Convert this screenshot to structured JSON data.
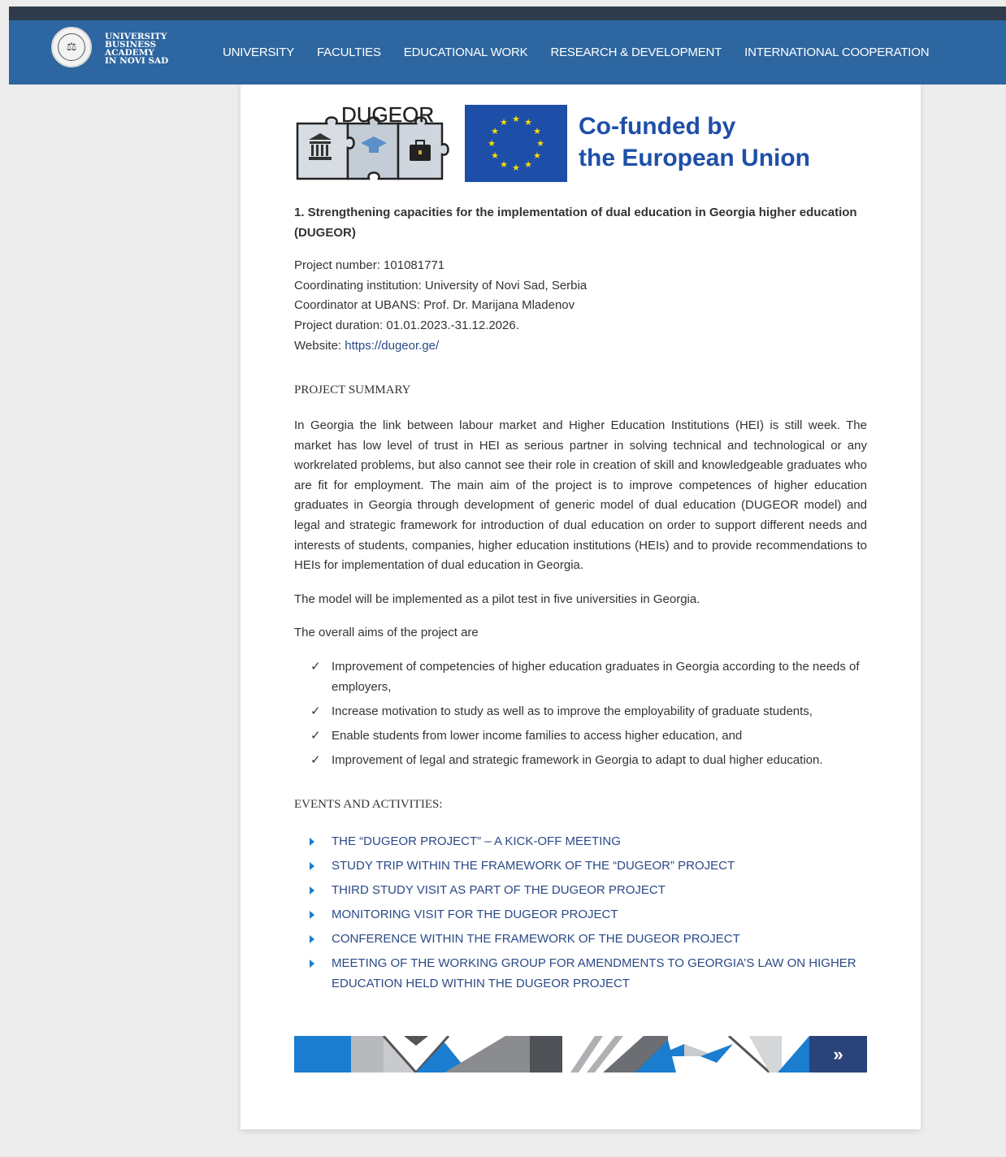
{
  "brand": {
    "name_lines": [
      "UNIVERSITY",
      "BUSINESS",
      "ACADEMY",
      "IN NOVI SAD"
    ]
  },
  "nav": {
    "items": [
      "UNIVERSITY",
      "FACULTIES",
      "EDUCATIONAL WORK",
      "RESEARCH & DEVELOPMENT",
      "INTERNATIONAL COOPERATION"
    ]
  },
  "banner": {
    "project_logo": "DUGEOR",
    "eu_line1": "Co-funded by",
    "eu_line2": "the European Union"
  },
  "project": {
    "title": "1. Strengthening capacities for the implementation of dual education in Georgia higher education (DUGEOR)",
    "number": "Project number: 101081771",
    "coordinating": "Coordinating institution: University of Novi Sad, Serbia",
    "coordinator": "Coordinator at UBANS: Prof. Dr. Marijana Mladenov",
    "duration": "Project duration:  01.01.2023.-31.12.2026.",
    "website_label": "Website: ",
    "website_url": "https://dugeor.ge/"
  },
  "summary": {
    "heading": "PROJECT SUMMARY",
    "para1": "In Georgia the link between labour market and Higher Education Institutions (HEI) is still week. The market has low level of trust in HEI as serious partner in solving technical and technological or any workrelated problems, but also cannot see their role in creation of skill and knowledgeable graduates who are fit for employment. The main aim of the project is to improve competences of higher education graduates in Georgia through development of generic model of dual education (DUGEOR model) and legal and strategic framework for introduction of dual education on order to support different needs and interests of students, companies, higher education institutions (HEIs) and to provide recommendations to HEIs for implementation of dual education in Georgia.",
    "para2": "The model will be implemented as a pilot test in five universities in Georgia.",
    "para3": "The overall aims of the project are",
    "aims": [
      "Improvement of competencies of higher education graduates in Georgia according to the needs of employers,",
      "Increase motivation to study as well as to improve the employability of graduate students,",
      "Enable students from lower income families to access higher education, and",
      "Improvement of legal and strategic framework in Georgia to adapt to dual higher education."
    ],
    "check_glyph": "✓"
  },
  "events": {
    "heading": "EVENTS AND ACTIVITIES:",
    "items": [
      "THE “DUGEOR PROJECT” – A KICK-OFF MEETING",
      "STUDY TRIP WITHIN THE FRAMEWORK OF THE “DUGEOR” PROJECT",
      "THIRD STUDY VISIT AS PART OF THE DUGEOR PROJECT",
      "MONITORING VISIT FOR THE DUGEOR PROJECT",
      "CONFERENCE WITHIN THE FRAMEWORK OF THE DUGEOR PROJECT",
      "MEETING OF THE WORKING GROUP FOR AMENDMENTS TO GEORGIA’S LAW ON HIGHER EDUCATION HELD WITHIN THE DUGEOR PROJECT"
    ]
  },
  "footer": {
    "next_glyph": "»"
  },
  "colors": {
    "nav_bg": "#2d66a0",
    "link": "#2a4a86",
    "eu_blue": "#1e4fa8",
    "bullet": "#1a7dd0"
  }
}
